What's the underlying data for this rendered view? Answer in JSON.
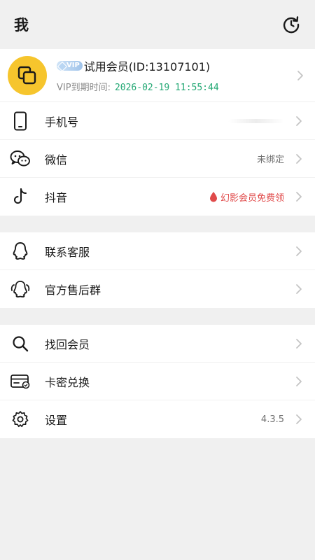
{
  "header": {
    "title": "我"
  },
  "profile": {
    "vip_badge": "VIP",
    "member_text": "试用会员(ID:13107101)",
    "expiry_label": "VIP到期时间:",
    "expiry_value": "2026-02-19 11:55:44"
  },
  "menu_group_1": [
    {
      "label": "手机号",
      "value": "",
      "icon": "phone-icon"
    },
    {
      "label": "微信",
      "value": "未绑定",
      "icon": "wechat-icon"
    },
    {
      "label": "抖音",
      "value": "幻影会员免费领",
      "icon": "tiktok-icon"
    }
  ],
  "menu_group_2": [
    {
      "label": "联系客服",
      "icon": "qq-icon"
    },
    {
      "label": "官方售后群",
      "icon": "qq-group-icon"
    }
  ],
  "menu_group_3": [
    {
      "label": "找回会员",
      "value": "",
      "icon": "search-icon"
    },
    {
      "label": "卡密兑换",
      "value": "",
      "icon": "card-icon"
    },
    {
      "label": "设置",
      "value": "4.3.5",
      "icon": "gear-icon"
    }
  ],
  "colors": {
    "avatar_bg": "#f6c52d",
    "expiry_text": "#23a874",
    "promo_text": "#e04a4a",
    "page_bg": "#f0f0f0"
  }
}
